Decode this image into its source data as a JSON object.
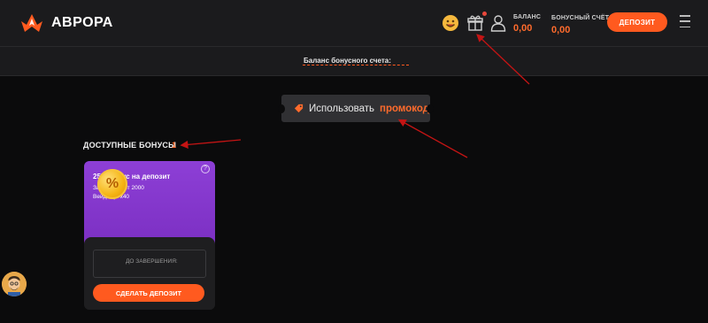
{
  "header": {
    "brand": "АВРОРА",
    "balance_label": "БАЛАНС",
    "balance_value": "0,00",
    "bonus_label": "БОНУСНЫЙ СЧЁТ",
    "bonus_value": "0,00",
    "deposit_button": "ДЕПОЗИТ",
    "icons": [
      "logo-icon",
      "smiley-icon",
      "gift-icon",
      "user-icon",
      "help-icon",
      "menu-icon"
    ]
  },
  "subbar": {
    "label": "Баланс бонусного счета:"
  },
  "promo": {
    "text": "Использовать",
    "accent": "промокод",
    "icon": "tag-icon"
  },
  "bonuses": {
    "title": "ДОСТУПНЫЕ БОНУСЫ",
    "count": "1",
    "card": {
      "title": "25% бонус на депозит",
      "line1": "За депозит от 2000",
      "line2": "Вейджер: х40",
      "coin": "%",
      "help": "?",
      "timer_label": "ДО ЗАВЕРШЕНИЯ:",
      "cta": "СДЕЛАТЬ ДЕПОЗИТ"
    }
  },
  "colors": {
    "accent": "#ff5a1f",
    "card_purple": "#8d3fd6",
    "background": "#0b0b0c",
    "annotation_arrow": "#c41414"
  }
}
